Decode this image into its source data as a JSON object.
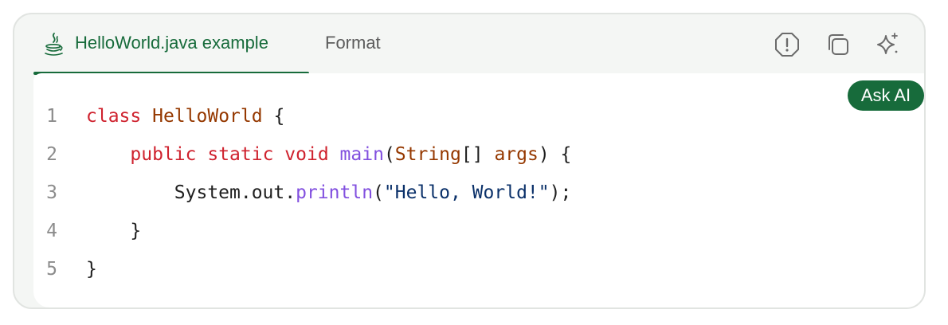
{
  "colors": {
    "accent": "#176b3b",
    "keyword": "#cf222e",
    "type": "#953800",
    "function": "#8250df",
    "string": "#0a3069",
    "plain": "#1f1f1f"
  },
  "tabs": {
    "active": {
      "label": "HelloWorld.java example",
      "icon": "java-icon"
    },
    "format": {
      "label": "Format"
    }
  },
  "toolbar": {
    "report_icon": "report-icon",
    "copy_icon": "copy-icon",
    "sparkle_icon": "sparkle-icon"
  },
  "ask_ai": {
    "label": "Ask AI"
  },
  "code": {
    "language": "java",
    "lines": [
      {
        "number": "1",
        "indent": "",
        "tokens": [
          {
            "text": "class",
            "kind": "keyword"
          },
          {
            "text": " ",
            "kind": "plain"
          },
          {
            "text": "HelloWorld",
            "kind": "type"
          },
          {
            "text": " {",
            "kind": "plain"
          }
        ]
      },
      {
        "number": "2",
        "indent": "    ",
        "tokens": [
          {
            "text": "public",
            "kind": "keyword"
          },
          {
            "text": " ",
            "kind": "plain"
          },
          {
            "text": "static",
            "kind": "keyword"
          },
          {
            "text": " ",
            "kind": "plain"
          },
          {
            "text": "void",
            "kind": "keyword"
          },
          {
            "text": " ",
            "kind": "plain"
          },
          {
            "text": "main",
            "kind": "func"
          },
          {
            "text": "(",
            "kind": "plain"
          },
          {
            "text": "String",
            "kind": "type"
          },
          {
            "text": "[] ",
            "kind": "plain"
          },
          {
            "text": "args",
            "kind": "type"
          },
          {
            "text": ") {",
            "kind": "plain"
          }
        ]
      },
      {
        "number": "3",
        "indent": "        ",
        "tokens": [
          {
            "text": "System.out.",
            "kind": "plain"
          },
          {
            "text": "println",
            "kind": "func"
          },
          {
            "text": "(",
            "kind": "plain"
          },
          {
            "text": "\"Hello, World!\"",
            "kind": "string"
          },
          {
            "text": ");",
            "kind": "plain"
          }
        ]
      },
      {
        "number": "4",
        "indent": "    ",
        "tokens": [
          {
            "text": "}",
            "kind": "plain"
          }
        ]
      },
      {
        "number": "5",
        "indent": "",
        "tokens": [
          {
            "text": "}",
            "kind": "plain"
          }
        ]
      }
    ]
  }
}
